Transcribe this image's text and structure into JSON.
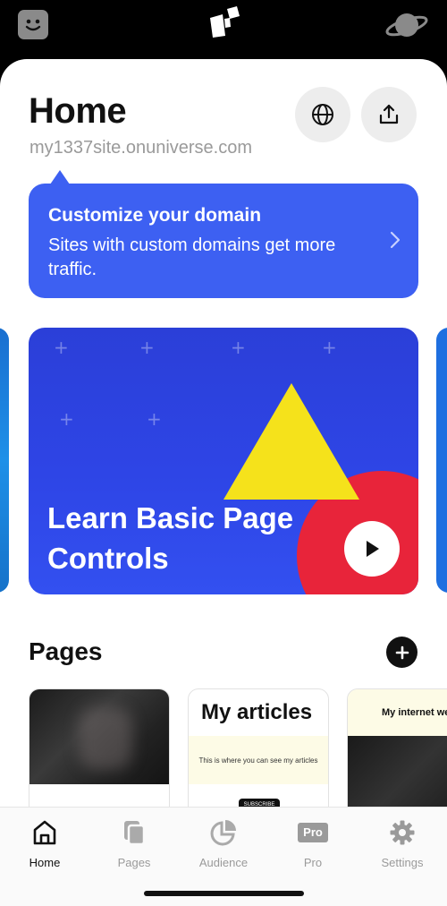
{
  "colors": {
    "accent": "#3d60f2",
    "video_bg": "#2e45e6",
    "triangle": "#f5e21b",
    "circle": "#e8243a"
  },
  "topbar": {
    "left_icon": "face-icon",
    "center_icon": "universe-logo-icon",
    "right_icon": "planet-icon"
  },
  "header": {
    "title": "Home",
    "subtitle": "my1337site.onuniverse.com",
    "globe_icon": "globe-icon",
    "share_icon": "share-icon"
  },
  "banner": {
    "title": "Customize your domain",
    "text": "Sites with custom domains get more traffic."
  },
  "video": {
    "title": "Learn Basic Page Controls",
    "play_icon": "play-icon"
  },
  "pages": {
    "title": "Pages",
    "add_icon": "plus-icon",
    "thumbnails": [
      {
        "title": ""
      },
      {
        "title": "My articles",
        "text": "This is where you can see my articles",
        "button": "SUBSCRIBE"
      },
      {
        "title": "My internet websi"
      }
    ]
  },
  "tabbar": {
    "active": "Home",
    "tabs": [
      {
        "label": "Home",
        "icon": "home-icon"
      },
      {
        "label": "Pages",
        "icon": "pages-icon"
      },
      {
        "label": "Audience",
        "icon": "audience-icon"
      },
      {
        "label": "Pro",
        "icon": "pro-icon",
        "badge": "Pro"
      },
      {
        "label": "Settings",
        "icon": "gear-icon"
      }
    ]
  }
}
